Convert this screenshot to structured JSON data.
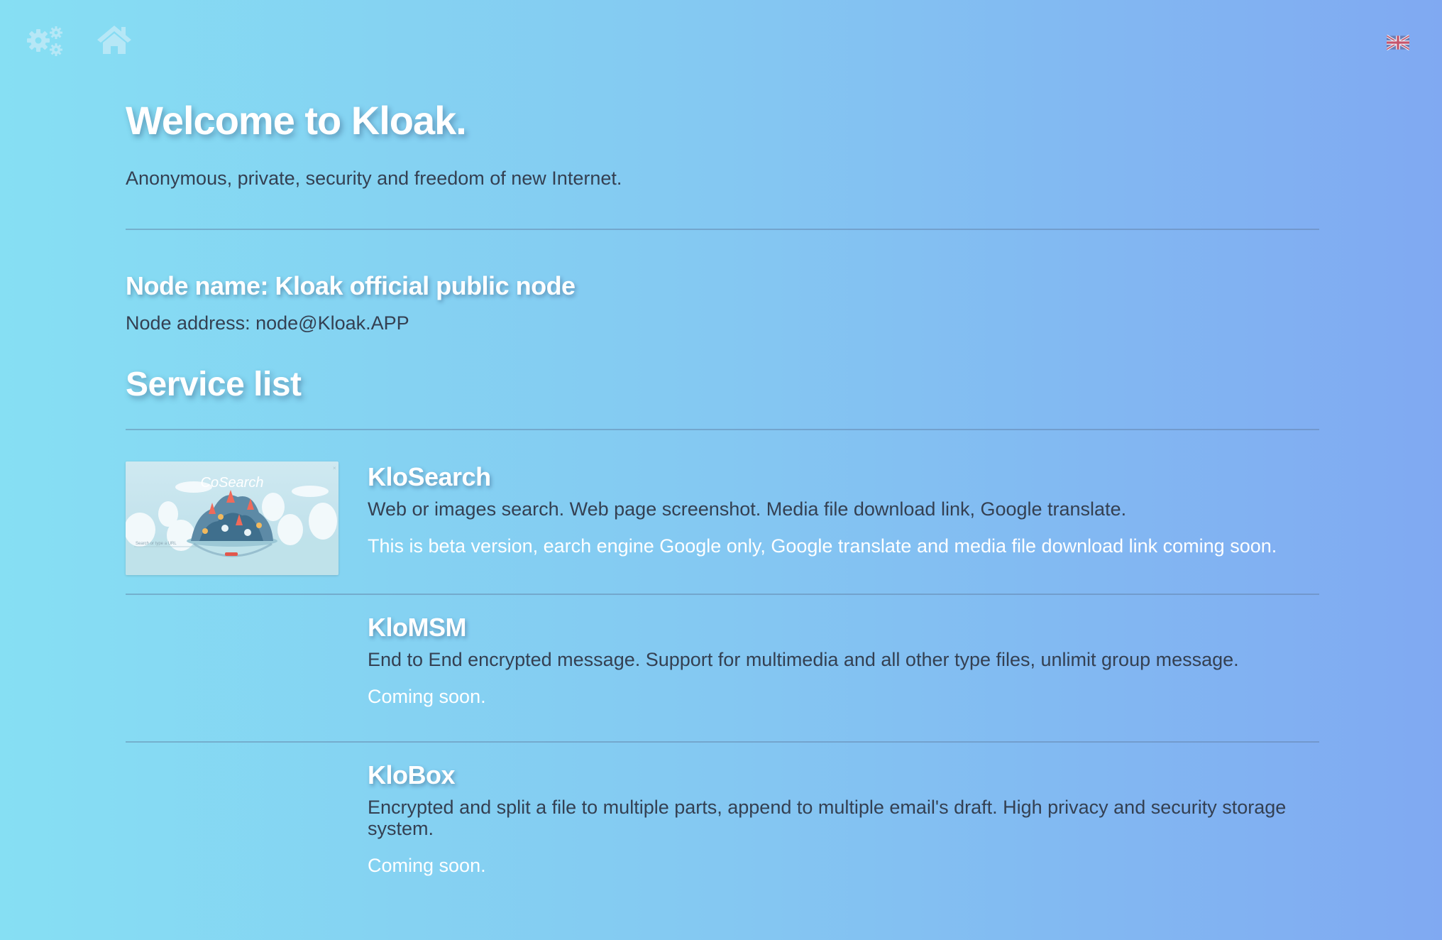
{
  "topbar": {
    "settings_icon": "gears-icon",
    "home_icon": "home-icon",
    "language_icon": "uk-flag-icon"
  },
  "header": {
    "title": "Welcome to Kloak.",
    "subtitle": "Anonymous, private, security and freedom of new Internet."
  },
  "node": {
    "name": "Node name: Kloak official public node",
    "address": "Node address: node@Kloak.APP"
  },
  "services": {
    "heading": "Service list",
    "items": [
      {
        "title": "KloSearch",
        "description": "Web or images search. Web page screenshot. Media file download link, Google translate.",
        "status": "This is beta version, earch engine Google only, Google translate and media file download link coming soon.",
        "thumbnail": {
          "brand": "CoSearch",
          "search_placeholder": "Search or type a URL"
        }
      },
      {
        "title": "KloMSM",
        "description": "End to End encrypted message. Support for multimedia and all other type files, unlimit group message.",
        "status": "Coming soon."
      },
      {
        "title": "KloBox",
        "description": "Encrypted and split a file to multiple parts, append to multiple email's draft. High privacy and security storage system.",
        "status": "Coming soon."
      }
    ]
  },
  "colors": {
    "gradient_start": "#86dff3",
    "gradient_end": "#80a9f2",
    "heading_text": "#ffffff",
    "body_text": "#344052"
  }
}
